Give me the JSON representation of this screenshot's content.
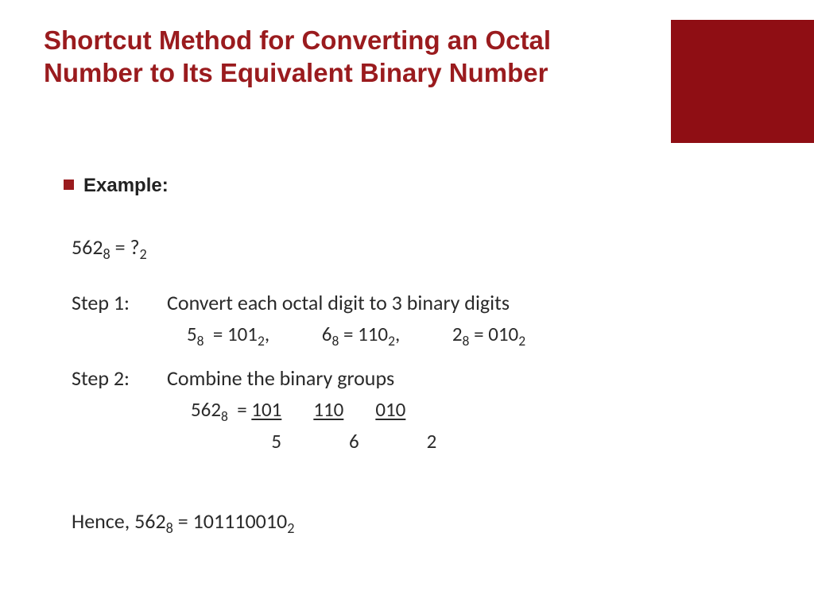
{
  "title": "Shortcut Method for Converting an Octal Number to Its Equivalent Binary Number",
  "example_label": "Example:",
  "equation": {
    "lhs_num": "562",
    "lhs_base": "8",
    "eq": " = ",
    "rhs_num": "?",
    "rhs_base": "2"
  },
  "step1": {
    "label": "Step 1:",
    "text": "Convert each octal digit to 3 binary digits",
    "conversions": [
      {
        "od": "5",
        "ob": "8",
        "bd": "101",
        "bb": "2"
      },
      {
        "od": "6",
        "ob": "8",
        "bd": "110",
        "bb": "2"
      },
      {
        "od": "2",
        "ob": "8",
        "bd": "010",
        "bb": "2"
      }
    ]
  },
  "step2": {
    "label": "Step 2:",
    "text": "Combine the binary groups",
    "lhs_num": "562",
    "lhs_base": "8",
    "eq": " = ",
    "groups": [
      "101",
      "110",
      "010"
    ],
    "digits": [
      "5",
      "6",
      "2"
    ]
  },
  "hence": {
    "prefix": "Hence, ",
    "lhs_num": "562",
    "lhs_base": "8",
    "eq": " = ",
    "rhs_num": "101110010",
    "rhs_base": "2"
  }
}
